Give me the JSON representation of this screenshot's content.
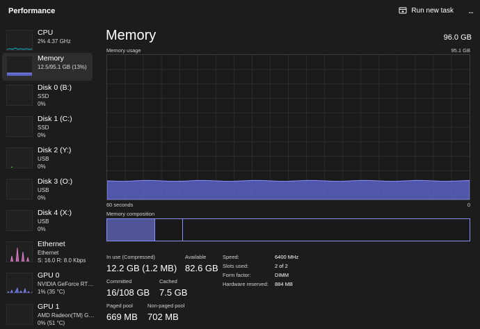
{
  "header": {
    "title": "Performance",
    "run_new_task_label": "Run new task",
    "more_label": "..."
  },
  "sidebar": {
    "items": [
      {
        "name": "CPU",
        "line1": "2%  4.37 GHz",
        "line2": "",
        "graph_color": "#17b3c9"
      },
      {
        "name": "Memory",
        "line1": "12.5/95.1 GB (13%)",
        "line2": "",
        "graph_color": "#7f86ff"
      },
      {
        "name": "Disk 0 (B:)",
        "line1": "SSD",
        "line2": "0%",
        "graph_color": "#5dbf4e"
      },
      {
        "name": "Disk 1 (C:)",
        "line1": "SSD",
        "line2": "0%",
        "graph_color": "#5dbf4e"
      },
      {
        "name": "Disk 2 (Y:)",
        "line1": "USB",
        "line2": "0%",
        "graph_color": "#5dbf4e"
      },
      {
        "name": "Disk 3 (O:)",
        "line1": "USB",
        "line2": "0%",
        "graph_color": "#5dbf4e"
      },
      {
        "name": "Disk 4 (X:)",
        "line1": "USB",
        "line2": "0%",
        "graph_color": "#5dbf4e"
      },
      {
        "name": "Ethernet",
        "line1": "Ethernet",
        "line2": "S: 16.0  R: 8.0 Kbps",
        "graph_color": "#e38bd0"
      },
      {
        "name": "GPU 0",
        "line1": "NVIDIA GeForce RTX ...",
        "line2": "1%  (35 °C)",
        "graph_color": "#7f86ff"
      },
      {
        "name": "GPU 1",
        "line1": "AMD Radeon(TM) Gra...",
        "line2": "0%  (51 °C)",
        "graph_color": "#7f86ff"
      }
    ]
  },
  "main": {
    "title": "Memory",
    "total": "96.0 GB",
    "usage_label": "Memory usage",
    "usage_max": "95.1 GB",
    "time_label": "60 seconds",
    "time_end": "0",
    "usage_fraction": 0.13,
    "composition_label": "Memory composition",
    "stats": {
      "in_use_label": "In use (Compressed)",
      "in_use_value": "12.2 GB (1.2 MB)",
      "available_label": "Available",
      "available_value": "82.6 GB",
      "committed_label": "Committed",
      "committed_value": "16/108 GB",
      "cached_label": "Cached",
      "cached_value": "7.5 GB",
      "paged_pool_label": "Paged pool",
      "paged_pool_value": "669 MB",
      "non_paged_pool_label": "Non-paged pool",
      "non_paged_pool_value": "702 MB"
    },
    "details": [
      {
        "label": "Speed:",
        "value": "6400 MHz"
      },
      {
        "label": "Slots used:",
        "value": "2 of 2"
      },
      {
        "label": "Form factor:",
        "value": "DIMM"
      },
      {
        "label": "Hardware reserved:",
        "value": "884 MB"
      }
    ]
  },
  "colors": {
    "memory_accent": "#8a8fff",
    "memory_fill": "#5a62c4",
    "background": "#1c1c1c"
  }
}
